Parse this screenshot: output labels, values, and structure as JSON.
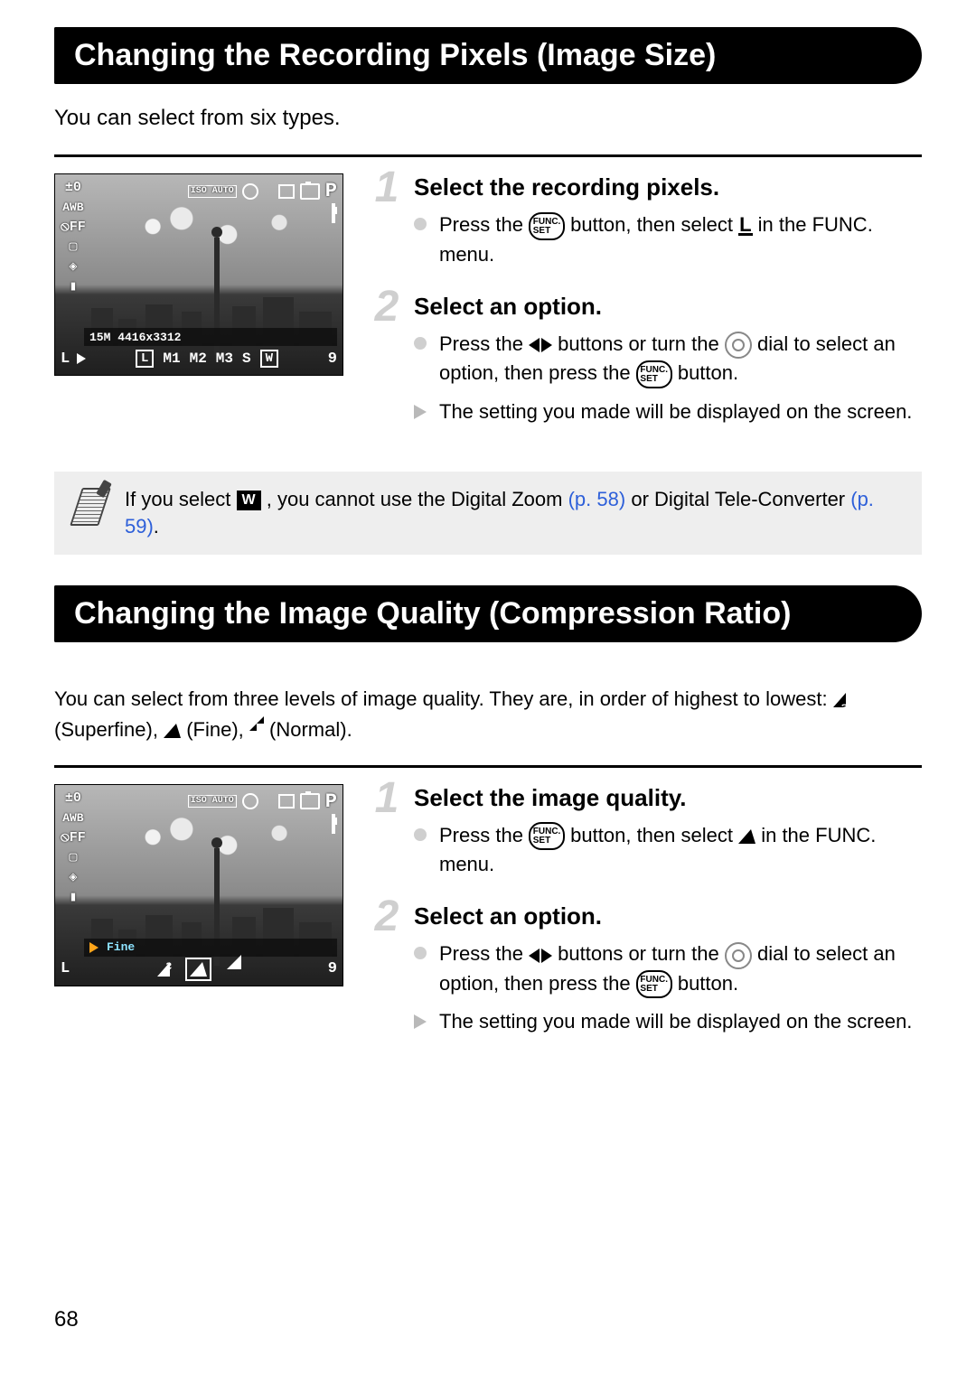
{
  "page_number": "68",
  "section1": {
    "heading": "Changing the Recording Pixels (Image Size)",
    "intro": "You can select from six types.",
    "lcd": {
      "ev": "±0",
      "wb": "AWB",
      "flash": "⦸FF",
      "drive": "▢",
      "meter": "◈",
      "focus": "▮",
      "iso": "ISO\nAUTO",
      "mode": "P",
      "info_text": "15M 4416x3312",
      "option_left": "L",
      "options": [
        "M1",
        "M2",
        "M3",
        "S",
        "W"
      ],
      "right_label": "9"
    },
    "steps": [
      {
        "num": "1",
        "title": "Select the recording pixels.",
        "bullets": [
          {
            "kind": "dot",
            "text_before": "Press the ",
            "text_mid": " button, then select ",
            "text_after": " in the FUNC. menu."
          }
        ]
      },
      {
        "num": "2",
        "title": "Select an option.",
        "bullets": [
          {
            "kind": "dot",
            "text_before": "Press the ",
            "text_mid": " buttons or turn the ",
            "text_mid2": " dial to select an option, then press the ",
            "text_after": " button."
          },
          {
            "kind": "tri",
            "text": "The setting you made will be displayed on the screen."
          }
        ]
      }
    ],
    "note": {
      "text_before": "If you select ",
      "text_mid": ", you cannot use the Digital Zoom ",
      "ref1": "(p. 58)",
      "text_mid2": " or Digital Tele-Converter ",
      "ref2": "(p. 59)",
      "text_after": "."
    }
  },
  "section2": {
    "heading": "Changing the Image Quality (Compression Ratio)",
    "intro_a": "You can select from three levels of image quality. They are, in order of highest to lowest: ",
    "levels": {
      "superfine": "(Superfine),",
      "fine": "(Fine),",
      "normal": "(Normal)."
    },
    "lcd": {
      "ev": "±0",
      "wb": "AWB",
      "flash": "⦸FF",
      "drive": "▢",
      "meter": "◈",
      "focus": "▮",
      "iso": "ISO\nAUTO",
      "mode": "P",
      "info_text": "Fine",
      "option_left": "L",
      "right_label": "9"
    },
    "steps": [
      {
        "num": "1",
        "title": "Select the image quality.",
        "bullets": [
          {
            "kind": "dot",
            "text_before": "Press the ",
            "text_mid": " button, then select ",
            "text_after": " in the FUNC. menu."
          }
        ]
      },
      {
        "num": "2",
        "title": "Select an option.",
        "bullets": [
          {
            "kind": "dot",
            "text_before": "Press the ",
            "text_mid": " buttons or turn the ",
            "text_mid2": " dial to select an option, then press the ",
            "text_after": " button."
          },
          {
            "kind": "tri",
            "text": "The setting you made will be displayed on the screen."
          }
        ]
      }
    ]
  }
}
